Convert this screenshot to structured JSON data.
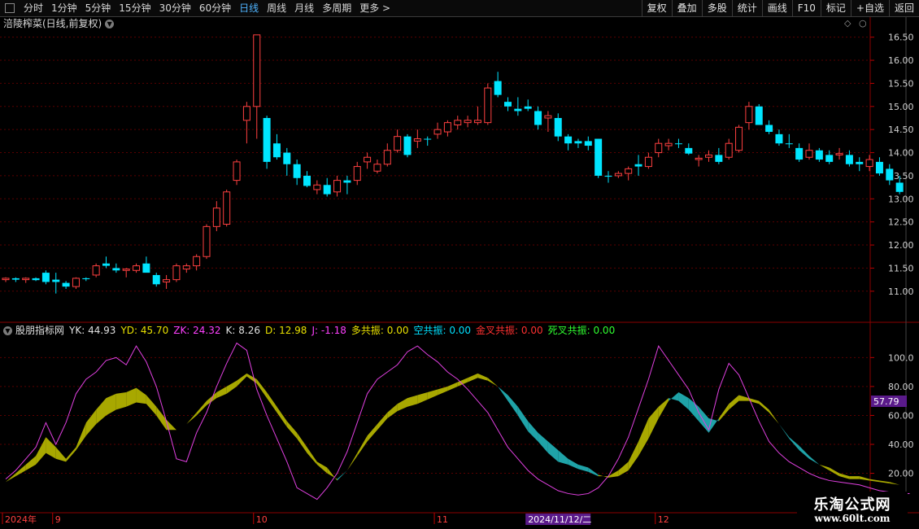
{
  "toolbar": {
    "periods": [
      "分时",
      "1分钟",
      "5分钟",
      "15分钟",
      "30分钟",
      "60分钟",
      "日线",
      "周线",
      "月线",
      "多周期",
      "更多 >"
    ],
    "active_period": "日线",
    "buttons": [
      "复权",
      "叠加",
      "多股",
      "统计",
      "画线",
      "F10",
      "标记",
      "+自选",
      "返回"
    ]
  },
  "chart_title": {
    "name": "涪陵榨菜(日线,前复权)"
  },
  "indicator": {
    "name": "股朋指标网",
    "items": [
      {
        "label": "YK: 44.93",
        "color": "#e0e0e0"
      },
      {
        "label": "YD: 45.70",
        "color": "#e8e000"
      },
      {
        "label": "ZK: 24.32",
        "color": "#ff40ff"
      },
      {
        "label": "K: 8.26",
        "color": "#e0e0e0"
      },
      {
        "label": "D: 12.98",
        "color": "#e8e000"
      },
      {
        "label": "J: -1.18",
        "color": "#ff40ff"
      },
      {
        "label": "多共振: 0.00",
        "color": "#e8e000"
      },
      {
        "label": "空共振: 0.00",
        "color": "#00e0ff"
      },
      {
        "label": "金叉共振: 0.00",
        "color": "#ff3030"
      },
      {
        "label": "死叉共振: 0.00",
        "color": "#30ff30"
      }
    ],
    "current_value_badge": "57.79"
  },
  "price_axis": {
    "ticks": [
      "16.50",
      "16.00",
      "15.50",
      "15.00",
      "14.50",
      "14.00",
      "13.50",
      "13.00",
      "12.50",
      "12.00",
      "11.50",
      "11.00"
    ],
    "ylim": [
      10.75,
      16.6
    ]
  },
  "ind_axis": {
    "ticks": [
      "100.0",
      "80.00",
      "60.00",
      "40.00",
      "20.00"
    ],
    "ylim": [
      -5,
      112
    ]
  },
  "date_axis": {
    "labels": [
      {
        "text": "2024年",
        "idx": 0
      },
      {
        "text": "9",
        "idx": 5
      },
      {
        "text": "10",
        "idx": 25
      },
      {
        "text": "11",
        "idx": 43
      },
      {
        "text": "12",
        "idx": 65
      }
    ],
    "cursor_label": "2024/11/12/二",
    "cursor_idx": 52
  },
  "logo": {
    "main": "乐淘公式网",
    "url": "www.60lt.com"
  },
  "colors": {
    "up": "#ff4040",
    "down": "#00e5ff",
    "bull_band": "#a8a800",
    "bear_band": "#1fa3a8",
    "j_line": "#e040e0",
    "grid": "#5a0000"
  },
  "chart_data": {
    "type": "candlestick",
    "ohlc": [
      [
        11.25,
        11.3,
        11.2,
        11.28
      ],
      [
        11.28,
        11.3,
        11.2,
        11.25
      ],
      [
        11.25,
        11.3,
        11.18,
        11.28
      ],
      [
        11.28,
        11.3,
        11.22,
        11.24
      ],
      [
        11.4,
        11.45,
        11.15,
        11.2
      ],
      [
        11.25,
        11.4,
        10.95,
        11.2
      ],
      [
        11.18,
        11.22,
        11.05,
        11.1
      ],
      [
        11.1,
        11.3,
        11.05,
        11.28
      ],
      [
        11.28,
        11.3,
        11.22,
        11.26
      ],
      [
        11.35,
        11.6,
        11.3,
        11.55
      ],
      [
        11.6,
        11.75,
        11.5,
        11.55
      ],
      [
        11.5,
        11.6,
        11.4,
        11.45
      ],
      [
        11.45,
        11.5,
        11.3,
        11.48
      ],
      [
        11.45,
        11.6,
        11.4,
        11.55
      ],
      [
        11.6,
        11.75,
        11.55,
        11.4
      ],
      [
        11.35,
        11.4,
        11.1,
        11.15
      ],
      [
        11.2,
        11.35,
        11.05,
        11.25
      ],
      [
        11.25,
        11.6,
        11.2,
        11.55
      ],
      [
        11.48,
        11.6,
        11.4,
        11.55
      ],
      [
        11.55,
        11.8,
        11.45,
        11.75
      ],
      [
        11.75,
        12.45,
        11.7,
        12.4
      ],
      [
        12.4,
        12.95,
        12.3,
        12.8
      ],
      [
        12.45,
        13.2,
        12.4,
        13.15
      ],
      [
        13.4,
        13.85,
        13.3,
        13.8
      ],
      [
        14.7,
        15.1,
        14.2,
        15.0
      ],
      [
        15.0,
        16.55,
        14.3,
        16.55
      ],
      [
        14.75,
        14.8,
        13.65,
        13.8
      ],
      [
        14.2,
        14.4,
        13.85,
        13.9
      ],
      [
        14.0,
        14.1,
        13.5,
        13.75
      ],
      [
        13.75,
        13.85,
        13.3,
        13.45
      ],
      [
        13.5,
        13.6,
        13.25,
        13.28
      ],
      [
        13.2,
        13.4,
        13.1,
        13.3
      ],
      [
        13.3,
        13.45,
        13.05,
        13.1
      ],
      [
        13.15,
        13.5,
        13.05,
        13.4
      ],
      [
        13.4,
        13.5,
        13.1,
        13.35
      ],
      [
        13.4,
        13.8,
        13.3,
        13.7
      ],
      [
        13.8,
        14.0,
        13.65,
        13.9
      ],
      [
        13.6,
        13.85,
        13.55,
        13.75
      ],
      [
        13.75,
        14.2,
        13.7,
        14.05
      ],
      [
        14.05,
        14.5,
        14.0,
        14.35
      ],
      [
        14.35,
        14.4,
        13.9,
        13.95
      ],
      [
        14.25,
        14.5,
        14.1,
        14.3
      ],
      [
        14.3,
        14.35,
        14.15,
        14.3
      ],
      [
        14.4,
        14.65,
        14.3,
        14.5
      ],
      [
        14.45,
        14.7,
        14.35,
        14.65
      ],
      [
        14.6,
        14.8,
        14.5,
        14.7
      ],
      [
        14.65,
        14.8,
        14.55,
        14.7
      ],
      [
        14.65,
        15.0,
        14.6,
        14.7
      ],
      [
        14.65,
        15.5,
        14.6,
        15.4
      ],
      [
        15.55,
        15.75,
        15.2,
        15.25
      ],
      [
        15.1,
        15.2,
        14.9,
        15.0
      ],
      [
        14.95,
        15.2,
        14.8,
        14.9
      ],
      [
        15.0,
        15.15,
        14.9,
        14.95
      ],
      [
        14.9,
        15.0,
        14.5,
        14.6
      ],
      [
        14.75,
        14.9,
        14.45,
        14.8
      ],
      [
        14.75,
        14.85,
        14.25,
        14.35
      ],
      [
        14.35,
        14.4,
        14.05,
        14.2
      ],
      [
        14.25,
        14.3,
        14.1,
        14.2
      ],
      [
        14.25,
        14.35,
        14.05,
        14.15
      ],
      [
        14.3,
        14.3,
        13.45,
        13.5
      ],
      [
        13.5,
        13.6,
        13.35,
        13.48
      ],
      [
        13.5,
        13.6,
        13.45,
        13.55
      ],
      [
        13.55,
        13.7,
        13.4,
        13.65
      ],
      [
        13.75,
        13.95,
        13.5,
        13.7
      ],
      [
        13.7,
        14.0,
        13.65,
        13.9
      ],
      [
        14.0,
        14.3,
        13.9,
        14.2
      ],
      [
        14.15,
        14.3,
        14.05,
        14.2
      ],
      [
        14.2,
        14.3,
        14.1,
        14.2
      ],
      [
        14.1,
        14.2,
        13.95,
        13.98
      ],
      [
        13.85,
        13.95,
        13.7,
        13.88
      ],
      [
        13.9,
        14.05,
        13.8,
        13.95
      ],
      [
        13.95,
        14.1,
        13.75,
        13.8
      ],
      [
        13.9,
        14.3,
        13.85,
        14.2
      ],
      [
        14.05,
        14.6,
        14.0,
        14.55
      ],
      [
        14.65,
        15.1,
        14.5,
        15.0
      ],
      [
        15.0,
        15.05,
        14.6,
        14.6
      ],
      [
        14.6,
        14.7,
        14.4,
        14.45
      ],
      [
        14.4,
        14.5,
        14.15,
        14.2
      ],
      [
        14.2,
        14.4,
        14.1,
        14.2
      ],
      [
        14.1,
        14.2,
        13.8,
        13.85
      ],
      [
        13.9,
        14.2,
        13.85,
        14.05
      ],
      [
        14.05,
        14.1,
        13.8,
        13.85
      ],
      [
        13.95,
        14.05,
        13.75,
        13.8
      ],
      [
        13.95,
        14.1,
        13.85,
        13.98
      ],
      [
        13.95,
        14.05,
        13.7,
        13.75
      ],
      [
        13.8,
        13.9,
        13.6,
        13.75
      ],
      [
        13.7,
        13.95,
        13.6,
        13.85
      ],
      [
        13.8,
        13.9,
        13.5,
        13.55
      ],
      [
        13.65,
        13.75,
        13.3,
        13.4
      ],
      [
        13.35,
        13.5,
        13.1,
        13.15
      ]
    ],
    "bands": {
      "a": [
        14,
        20,
        26,
        32,
        45,
        38,
        30,
        38,
        55,
        64,
        72,
        75,
        76,
        79,
        74,
        66,
        57,
        50,
        54,
        62,
        70,
        76,
        80,
        84,
        89,
        85,
        76,
        66,
        56,
        48,
        38,
        28,
        24,
        15,
        22,
        34,
        46,
        54,
        62,
        68,
        72,
        74,
        76,
        78,
        80,
        83,
        86,
        89,
        86,
        80,
        70,
        60,
        49,
        42,
        34,
        28,
        26,
        23,
        21,
        18,
        18,
        22,
        28,
        42,
        58,
        66,
        72,
        70,
        64,
        56,
        48,
        58,
        68,
        74,
        72,
        70,
        64,
        54,
        44,
        36,
        30,
        26,
        24,
        20,
        18,
        18,
        16,
        15,
        14,
        12,
        10
      ],
      "b": [
        14,
        18,
        22,
        26,
        34,
        30,
        28,
        36,
        46,
        54,
        60,
        64,
        66,
        69,
        68,
        60,
        50,
        50,
        54,
        60,
        67,
        72,
        75,
        80,
        87,
        82,
        72,
        62,
        52,
        44,
        34,
        26,
        20,
        16,
        22,
        32,
        42,
        50,
        58,
        63,
        66,
        68,
        71,
        74,
        77,
        80,
        83,
        86,
        84,
        80,
        74,
        66,
        56,
        48,
        42,
        36,
        30,
        26,
        24,
        19,
        17,
        18,
        22,
        32,
        44,
        58,
        70,
        76,
        72,
        66,
        58,
        56,
        64,
        70,
        70,
        68,
        62,
        54,
        45,
        39,
        32,
        26,
        22,
        18,
        16,
        16,
        15,
        14,
        13,
        12,
        11
      ]
    },
    "j_line": [
      16,
      22,
      30,
      38,
      55,
      40,
      55,
      75,
      85,
      90,
      98,
      100,
      95,
      108,
      97,
      80,
      56,
      30,
      28,
      48,
      62,
      80,
      96,
      110,
      105,
      78,
      60,
      44,
      28,
      10,
      6,
      2,
      10,
      20,
      35,
      55,
      75,
      85,
      90,
      95,
      104,
      108,
      102,
      97,
      90,
      85,
      78,
      70,
      62,
      50,
      38,
      30,
      22,
      16,
      12,
      8,
      6,
      5,
      6,
      10,
      18,
      30,
      45,
      65,
      85,
      108,
      98,
      88,
      78,
      62,
      50,
      78,
      96,
      88,
      72,
      56,
      42,
      34,
      28,
      24,
      20,
      17,
      15,
      14,
      13,
      12,
      10,
      8,
      7,
      6,
      6
    ]
  }
}
